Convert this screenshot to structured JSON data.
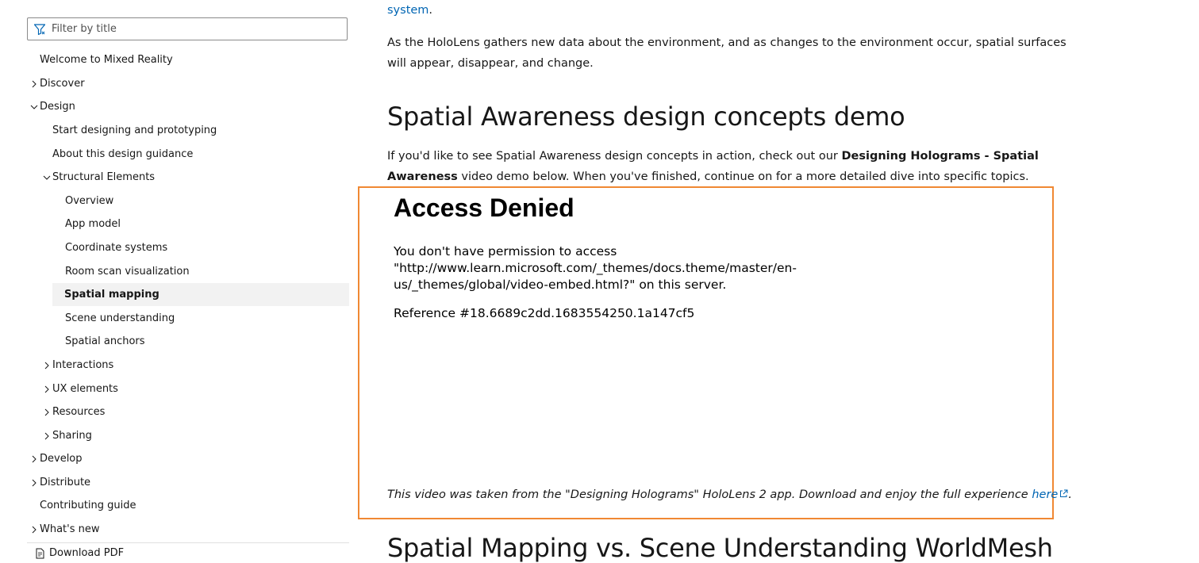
{
  "sidebar": {
    "filter": {
      "placeholder": "Filter by title"
    },
    "items": [
      {
        "label": "Welcome to Mixed Reality"
      },
      {
        "label": "Discover"
      },
      {
        "label": "Design"
      },
      {
        "label": "Start designing and prototyping"
      },
      {
        "label": "About this design guidance"
      },
      {
        "label": "Structural Elements"
      },
      {
        "label": "Overview"
      },
      {
        "label": "App model"
      },
      {
        "label": "Coordinate systems"
      },
      {
        "label": "Room scan visualization"
      },
      {
        "label": "Spatial mapping"
      },
      {
        "label": "Scene understanding"
      },
      {
        "label": "Spatial anchors"
      },
      {
        "label": "Interactions"
      },
      {
        "label": "UX elements"
      },
      {
        "label": "Resources"
      },
      {
        "label": "Sharing"
      },
      {
        "label": "Develop"
      },
      {
        "label": "Distribute"
      },
      {
        "label": "Contributing guide"
      },
      {
        "label": "What's new"
      }
    ],
    "download_label": "Download PDF"
  },
  "content": {
    "top_link": "system",
    "top_link_suffix": ".",
    "para1": "As the HoloLens gathers new data about the environment, and as changes to the environment occur, spatial surfaces will appear, disappear, and change.",
    "heading1": "Spatial Awareness design concepts demo",
    "para2_before": "If you'd like to see Spatial Awareness design concepts in action, check out our ",
    "para2_bold": "Designing Holograms - Spatial Awareness",
    "para2_after": " video demo below. When you've finished, continue on for a more detailed dive into specific topics.",
    "error": {
      "title": "Access Denied",
      "message": "You don't have permission to access \"http://www.learn.microsoft.com/_themes/docs.theme/master/en-us/_themes/global/video-embed.html?\" on this server.",
      "reference": "Reference #18.6689c2dd.1683554250.1a147cf5"
    },
    "caption_text": "This video was taken from the \"Designing Holograms\" HoloLens 2 app. Download and enjoy the full experience ",
    "caption_link": "here",
    "caption_suffix": ".",
    "heading2": "Spatial Mapping vs. Scene Understanding WorldMesh"
  },
  "colors": {
    "link": "#0065b3",
    "frame_border": "#f08833",
    "active_bg": "#f2f2f2"
  },
  "icons": {
    "filter": "filter-icon",
    "chevron_right": "chevron-right-icon",
    "chevron_down": "chevron-down-icon",
    "download": "pdf-icon",
    "external": "external-link-icon"
  }
}
